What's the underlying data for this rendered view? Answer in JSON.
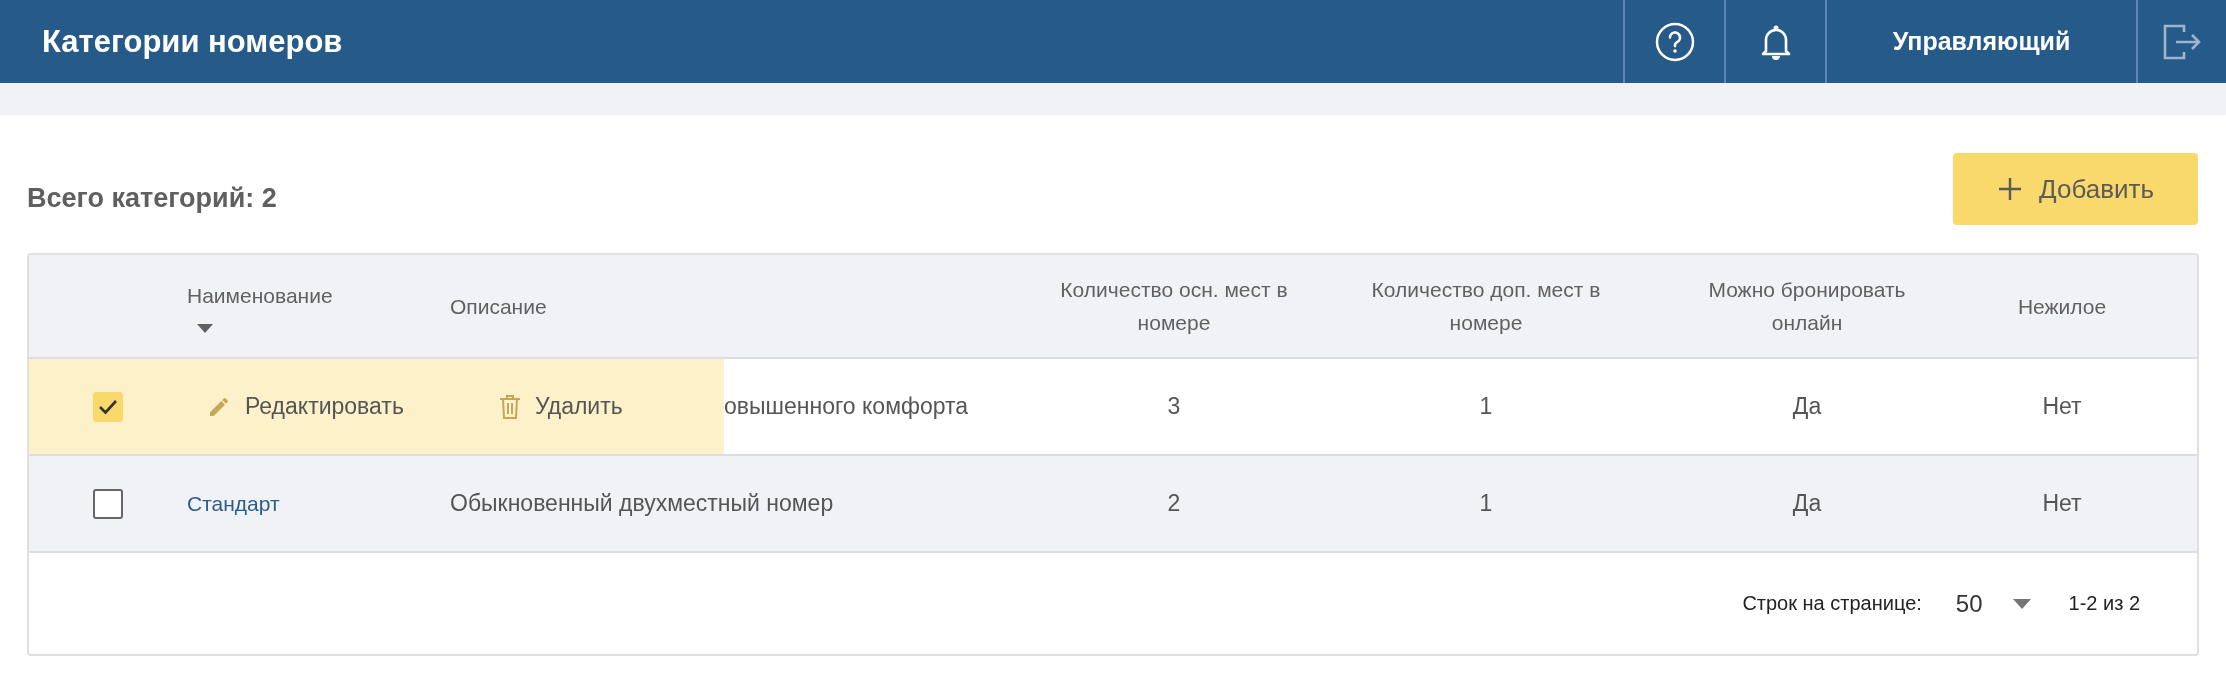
{
  "header": {
    "title": "Категории номеров",
    "user": "Управляющий"
  },
  "summary": "Всего категорий: 2",
  "add_button": "Добавить",
  "table": {
    "columns": [
      {
        "label": "Наименование",
        "sorted": true
      },
      {
        "label": "Описание",
        "sorted": false
      },
      {
        "label": "Количество осн. мест в номере",
        "sorted": false
      },
      {
        "label": "Количество доп. мест в номере",
        "sorted": false
      },
      {
        "label": "Можно бронировать онлайн",
        "sorted": false
      },
      {
        "label": "Нежилое",
        "sorted": false
      }
    ],
    "rows": [
      {
        "selected": true,
        "shaded": false,
        "action_bar": {
          "edit": "Редактировать",
          "delete": "Удалить"
        },
        "cells": [
          "",
          "овышенного комфорта",
          "3",
          "1",
          "Да",
          "Нет"
        ]
      },
      {
        "selected": false,
        "shaded": true,
        "cells": [
          "Стандарт",
          "Обыкновенный двухместный номер",
          "2",
          "1",
          "Да",
          "Нет"
        ]
      }
    ]
  },
  "pagination": {
    "label": "Строк на странице:",
    "per_page": "50",
    "range": "1-2 из 2"
  }
}
